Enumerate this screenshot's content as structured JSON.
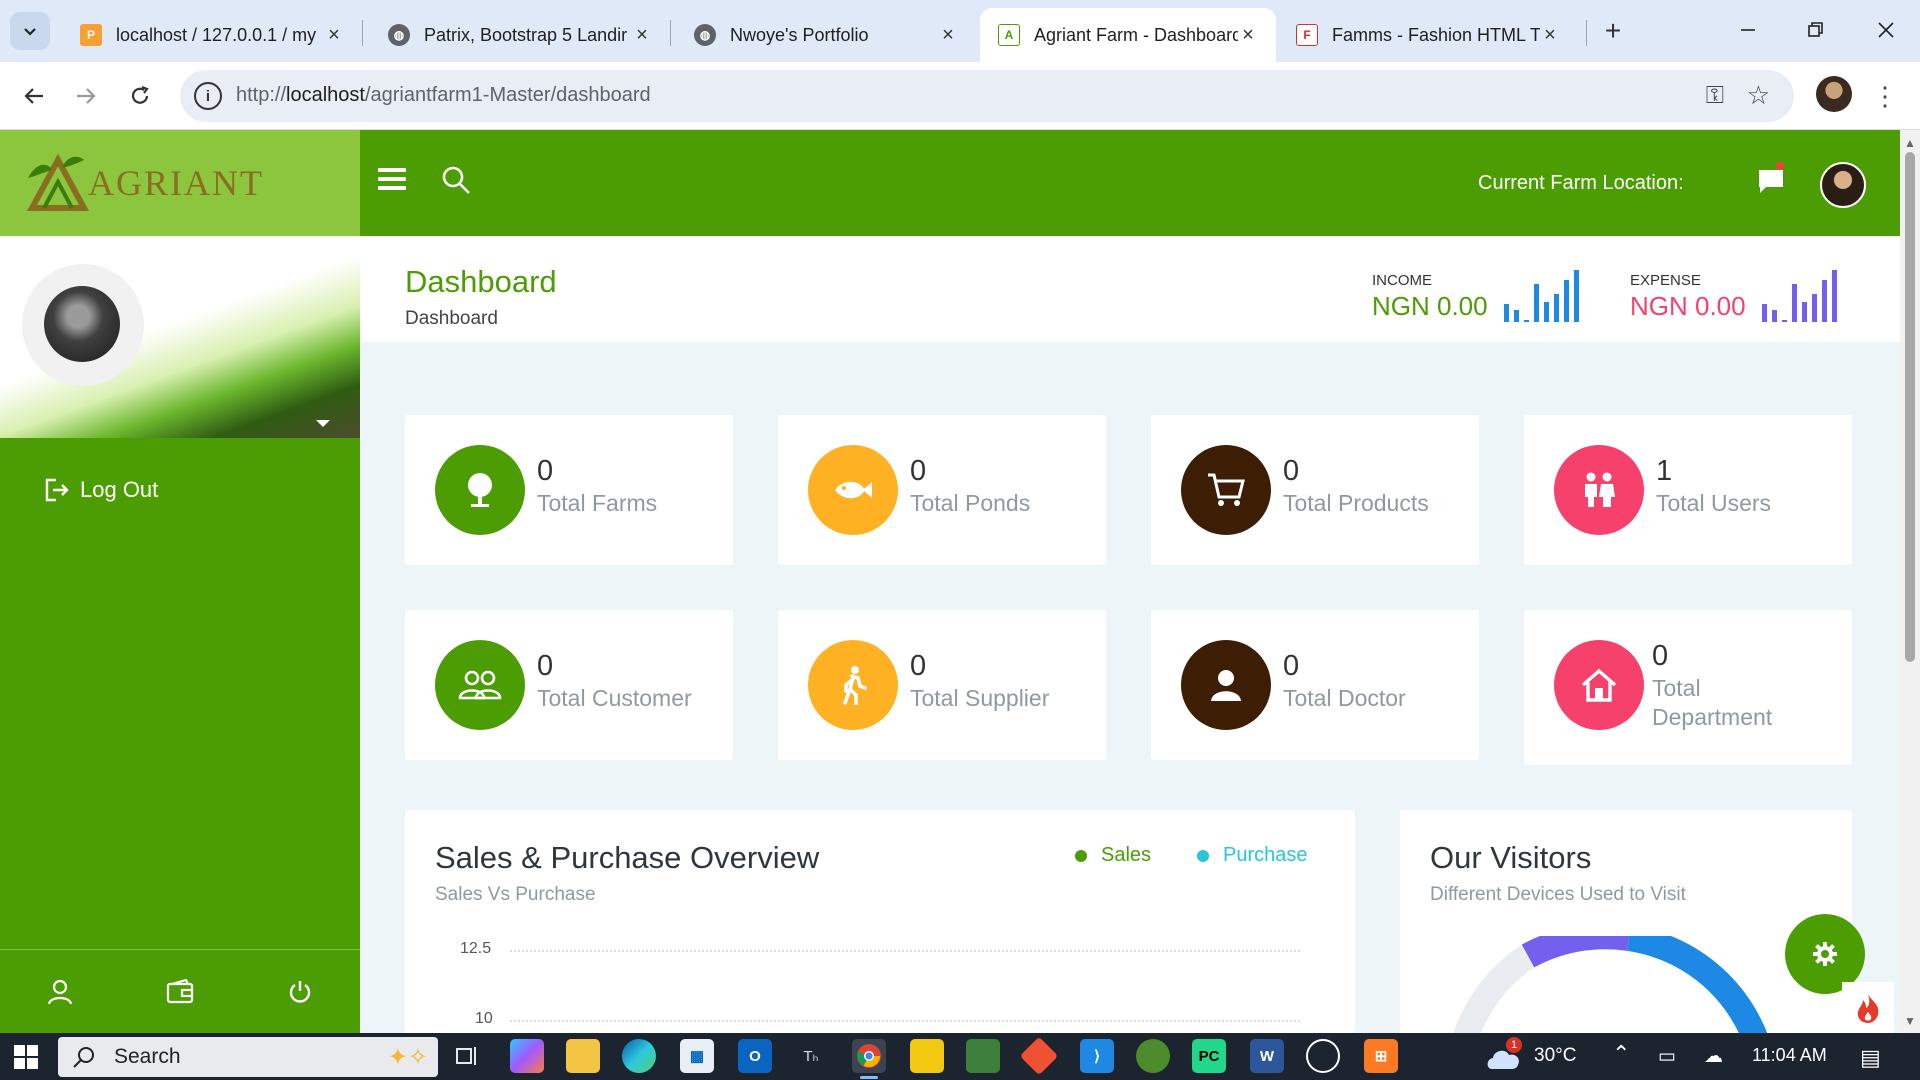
{
  "browser": {
    "tabs": [
      {
        "title": "localhost / 127.0.0.1 / my",
        "favicon": "phpmyadmin-icon",
        "active": false
      },
      {
        "title": "Patrix, Bootstrap 5 Landir",
        "favicon": "globe-icon",
        "active": false
      },
      {
        "title": "Nwoye's Portfolio",
        "favicon": "globe-icon",
        "active": false
      },
      {
        "title": "Agriant Farm - Dashboard",
        "favicon": "agriant-icon",
        "active": true
      },
      {
        "title": "Famms - Fashion HTML T",
        "favicon": "famms-icon",
        "active": false
      }
    ],
    "url_prefix": "http://",
    "url_host": "localhost",
    "url_path": "/agriantfarm1-Master/dashboard"
  },
  "brand": {
    "name": "AGRIANT"
  },
  "sidebar": {
    "logout_label": "Log Out",
    "footer_icons": [
      "user-icon",
      "wallet-icon",
      "power-icon"
    ]
  },
  "topnav": {
    "farm_location_label": "Current Farm Location:"
  },
  "page": {
    "title": "Dashboard",
    "breadcrumb": "Dashboard",
    "income": {
      "label": "INCOME",
      "value": "NGN 0.00",
      "color": "#4c9d04",
      "bar_color": "#1e88e5"
    },
    "expense": {
      "label": "EXPENSE",
      "value": "NGN 0.00",
      "color": "#f6416c",
      "bar_color": "#7460ee"
    }
  },
  "cards": [
    {
      "value": "0",
      "label": "Total Farms",
      "color": "green",
      "icon": "tree-icon"
    },
    {
      "value": "0",
      "label": "Total Ponds",
      "color": "orange",
      "icon": "fish-icon"
    },
    {
      "value": "0",
      "label": "Total Products",
      "color": "brown",
      "icon": "cart-icon"
    },
    {
      "value": "1",
      "label": "Total Users",
      "color": "pink",
      "icon": "users-icon"
    },
    {
      "value": "0",
      "label": "Total Customer",
      "color": "green",
      "icon": "customers-icon"
    },
    {
      "value": "0",
      "label": "Total Supplier",
      "color": "orange",
      "icon": "walking-icon"
    },
    {
      "value": "0",
      "label": "Total Doctor",
      "color": "brown",
      "icon": "person-icon"
    },
    {
      "value": "0",
      "label": "Total Department",
      "color": "pink",
      "icon": "home-icon"
    }
  ],
  "sales_panel": {
    "title": "Sales & Purchase Overview",
    "subtitle": "Sales Vs Purchase",
    "legend": [
      {
        "name": "Sales",
        "color": "#4c9d04"
      },
      {
        "name": "Purchase",
        "color": "#26c6da"
      }
    ],
    "y_ticks": [
      "12.5",
      "10"
    ]
  },
  "visitors_panel": {
    "title": "Our Visitors",
    "subtitle": "Different Devices Used to Visit"
  },
  "taskbar": {
    "search_placeholder": "Search",
    "weather": "30°C",
    "weather_badge": "1",
    "time": "11:04 AM"
  }
}
